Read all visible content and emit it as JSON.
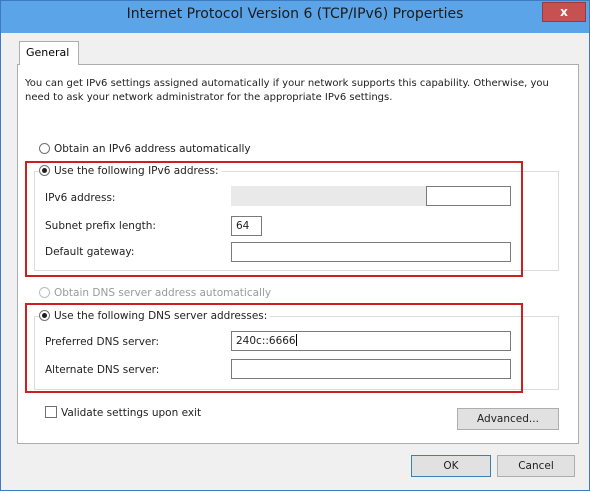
{
  "window": {
    "title": "Internet Protocol Version 6 (TCP/IPv6) Properties",
    "close_label": "x"
  },
  "tabs": [
    {
      "label": "General"
    }
  ],
  "description": "You can get IPv6 settings assigned automatically if your network supports this capability. Otherwise, you need to ask your network administrator for the appropriate IPv6 settings.",
  "address": {
    "auto_label": "Obtain an IPv6 address automatically",
    "auto_selected": false,
    "manual_label": "Use the following IPv6 address:",
    "manual_selected": true,
    "ipv6_label": "IPv6 address:",
    "ipv6_value": "",
    "prefix_label": "Subnet prefix length:",
    "prefix_value": "64",
    "gateway_label": "Default gateway:",
    "gateway_value": ""
  },
  "dns": {
    "auto_label": "Obtain DNS server address automatically",
    "auto_enabled": false,
    "manual_label": "Use the following DNS server addresses:",
    "manual_selected": true,
    "preferred_label": "Preferred DNS server:",
    "preferred_value": "240c::6666",
    "alternate_label": "Alternate DNS server:",
    "alternate_value": ""
  },
  "validate": {
    "label": "Validate settings upon exit",
    "checked": false
  },
  "buttons": {
    "advanced": "Advanced...",
    "ok": "OK",
    "cancel": "Cancel"
  },
  "colors": {
    "title_bar": "#5ba4e8",
    "highlight_box": "#cc1f1f",
    "close_button": "#c75050"
  }
}
